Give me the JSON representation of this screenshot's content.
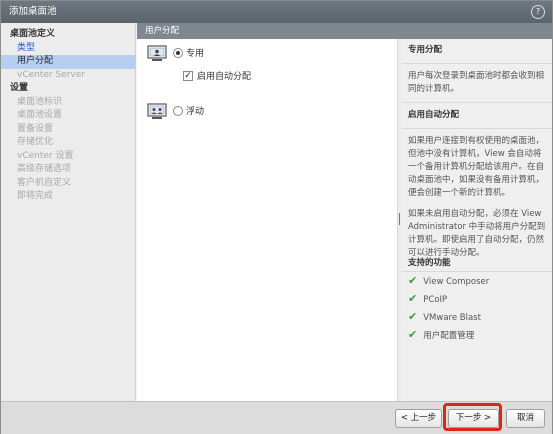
{
  "window": {
    "title": "添加桌面池",
    "help_icon": "?"
  },
  "nav": {
    "section1": "桌面池定义",
    "type": "类型",
    "user_assignment": "用户分配",
    "vcenter_server": "vCenter Server",
    "section2": "设置",
    "pool_id": "桌面池标识",
    "pool_settings": "桌面池设置",
    "provisioning": "置备设置",
    "storage_opt": "存储优化",
    "vcenter_settings": "vCenter 设置",
    "advanced_storage": "高级存储选项",
    "guest_custom": "客户机自定义",
    "ready": "即将完成"
  },
  "main": {
    "header": "用户分配",
    "dedicated": {
      "label": "专用",
      "selected": true
    },
    "auto_assign": {
      "label": "启用自动分配",
      "checked": true
    },
    "floating": {
      "label": "浮动",
      "selected": false
    }
  },
  "help_panel": {
    "title1": "专用分配",
    "text1": "用户每次登录到桌面池时都会收到相同的计算机。",
    "title2": "启用自动分配",
    "text2": "如果用户连接到有权使用的桌面池，但池中没有计算机，View 会自动将一个备用计算机分配给该用户。在自动桌面池中，如果没有备用计算机，便会创建一个新的计算机。",
    "text3": "如果未启用自动分配，必须在 View Administrator 中手动将用户分配到计算机。即使启用了自动分配，仍然可以进行手动分配。",
    "features_title": "支持的功能",
    "features": [
      "View Composer",
      "PCoIP",
      "VMware Blast",
      "用户配置管理"
    ]
  },
  "footer": {
    "back": "< 上一步",
    "next": "下一步 >",
    "cancel": "取消"
  },
  "colors": {
    "highlight": "#e2231a",
    "check": "#3a9b3a",
    "active_nav": "#b6cff0"
  }
}
